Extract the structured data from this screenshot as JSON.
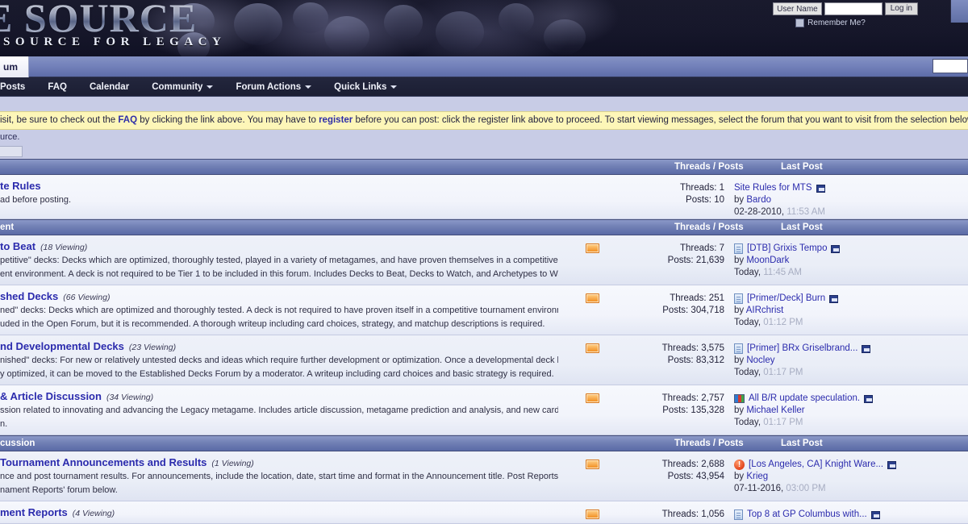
{
  "site": {
    "logo_title": "E SOURCE",
    "logo_subtitle": "SOURCE FOR LEGACY",
    "accent_color": "#2b2bad",
    "header_bg": "#16172a",
    "notice_bg": "#fdf6b8",
    "subforum_icon_color": "#f08a1b"
  },
  "login": {
    "username_label": "User Name",
    "username_value": "",
    "username_placeholder": "",
    "login_button": "Log in",
    "remember_label": "Remember Me?"
  },
  "tabs": {
    "active_tab": "um",
    "search_value": "",
    "search_placeholder": ""
  },
  "nav": {
    "items": [
      {
        "label": "Posts",
        "has_caret": false
      },
      {
        "label": "FAQ",
        "has_caret": false
      },
      {
        "label": "Calendar",
        "has_caret": false
      },
      {
        "label": "Community",
        "has_caret": true
      },
      {
        "label": "Forum Actions",
        "has_caret": true
      },
      {
        "label": "Quick Links",
        "has_caret": true
      }
    ]
  },
  "notice": {
    "text_1": "isit, be sure to check out the ",
    "link_faq": "FAQ",
    "text_2": " by clicking the link above. You may have to ",
    "link_register": "register",
    "text_3": " before you can post: click the register link above to proceed. To start viewing messages, select the forum that you want to visit from the selection below."
  },
  "breadcrumb": {
    "text": "urce."
  },
  "columns": {
    "threads_posts": "Threads / Posts",
    "last_post": "Last Post"
  },
  "categories": [
    {
      "title": "",
      "forums": [
        {
          "title": "te Rules",
          "viewing": "",
          "description": "ad before posting.",
          "has_sub_icon": false,
          "threads": "Threads: 1",
          "posts": "Posts: 10",
          "last_post_icon": "none",
          "last_post_title": "Site Rules for MTS",
          "last_post_by_prefix": "by ",
          "last_post_author": "Bardo",
          "last_post_date": "02-28-2010,",
          "last_post_time": "11:53 AM"
        }
      ]
    },
    {
      "title": "ent",
      "forums": [
        {
          "title": "to Beat",
          "viewing": "(18 Viewing)",
          "description": "petitive\" decks: Decks which are optimized, thoroughly tested, played in a variety of metagames, and have proven themselves in a competitive\nent environment. A deck is not required to be Tier 1 to be included in this forum. Includes Decks to Beat, Decks to Watch, and Archetypes to Watch.",
          "has_sub_icon": true,
          "threads": "Threads: 7",
          "posts": "Posts: 21,639",
          "last_post_icon": "page",
          "last_post_title": "[DTB] Grixis Tempo",
          "last_post_by_prefix": "by ",
          "last_post_author": "MoonDark",
          "last_post_date": "Today,",
          "last_post_time": "11:45 AM"
        },
        {
          "title": "shed Decks",
          "viewing": "(66 Viewing)",
          "description": "ned\" decks: Decks which are optimized and thoroughly tested. A deck is not required to have proven itself in a competitive tournament environment\nuded in the Open Forum, but it is recommended. A thorough writeup including card choices, strategy, and matchup descriptions is required.",
          "has_sub_icon": true,
          "threads": "Threads: 251",
          "posts": "Posts: 304,718",
          "last_post_icon": "page",
          "last_post_title": "[Primer/Deck] Burn",
          "last_post_by_prefix": "by ",
          "last_post_author": "AIRchrist",
          "last_post_date": "Today,",
          "last_post_time": "01:12 PM"
        },
        {
          "title": "nd Developmental Decks",
          "viewing": "(23 Viewing)",
          "description": "nished\" decks: For new or relatively untested decks and ideas which require further development or optimization. Once a developmental deck has\ny optimized, it can be moved to the Established Decks Forum by a moderator. A writeup including card choices and basic strategy is required.",
          "has_sub_icon": true,
          "threads": "Threads: 3,575",
          "posts": "Posts: 83,312",
          "last_post_icon": "page",
          "last_post_title": "[Primer] BRx Griselbrand...",
          "last_post_by_prefix": "by ",
          "last_post_author": "Nocley",
          "last_post_date": "Today,",
          "last_post_time": "01:17 PM"
        },
        {
          "title": "& Article Discussion",
          "viewing": "(34 Viewing)",
          "description": "ssion related to innovating and advancing the Legacy metagame. Includes article discussion, metagame prediction and analysis, and new card\nn.",
          "has_sub_icon": true,
          "threads": "Threads: 2,757",
          "posts": "Posts: 135,328",
          "last_post_icon": "poll",
          "last_post_title": "All B/R update speculation.",
          "last_post_by_prefix": "by ",
          "last_post_author": "Michael Keller",
          "last_post_date": "Today,",
          "last_post_time": "01:17 PM"
        }
      ]
    },
    {
      "title": "cussion",
      "forums": [
        {
          "title": "Tournament Announcements and Results",
          "viewing": "(1 Viewing)",
          "description": "nce and post tournament results. For announcements, include the location, date, start time and format in the Announcement title. Post Reports in\nnament Reports' forum below.",
          "has_sub_icon": true,
          "threads": "Threads: 2,688",
          "posts": "Posts: 43,954",
          "last_post_icon": "alert",
          "last_post_title": "[Los Angeles, CA] Knight Ware...",
          "last_post_by_prefix": "by ",
          "last_post_author": "Krieg",
          "last_post_date": "07-11-2016,",
          "last_post_time": "03:00 PM"
        },
        {
          "title": "ment Reports",
          "viewing": "(4 Viewing)",
          "description": "",
          "has_sub_icon": true,
          "threads": "Threads: 1,056",
          "posts": "",
          "last_post_icon": "page",
          "last_post_title": "Top 8 at GP Columbus with...",
          "last_post_by_prefix": "",
          "last_post_author": "",
          "last_post_date": "",
          "last_post_time": ""
        }
      ]
    }
  ]
}
